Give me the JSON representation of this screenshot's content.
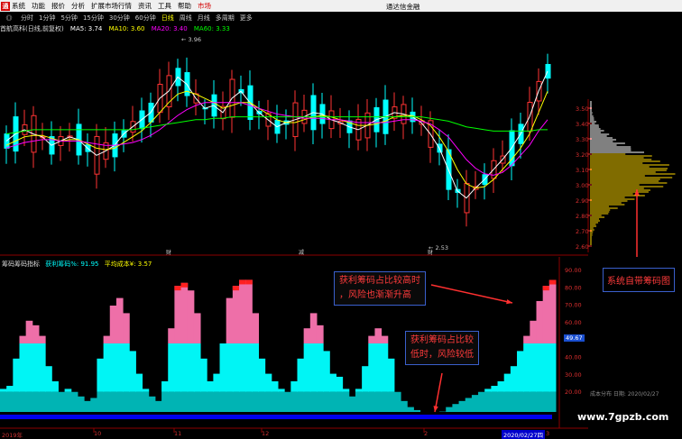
{
  "menu": {
    "logo": "通",
    "items": [
      "系统",
      "功能",
      "报价",
      "分析",
      "扩展市场行情",
      "资讯",
      "工具",
      "帮助",
      "市场"
    ],
    "active_index": 8,
    "brand": "通达信金融"
  },
  "periods": {
    "symbol_glyph": "《》",
    "items": [
      "分时",
      "1分钟",
      "5分钟",
      "15分钟",
      "30分钟",
      "60分钟",
      "日线",
      "周线",
      "月线",
      "多周期",
      "更多"
    ],
    "active_index": 6
  },
  "stock": {
    "name": "首航高科(日线,前复权)",
    "ma_lines": [
      {
        "label": "MA5: 3.74",
        "color": "#ffffff"
      },
      {
        "label": "MA10: 3.60",
        "color": "#ffff00"
      },
      {
        "label": "MA20: 3.40",
        "color": "#ff00ff"
      },
      {
        "label": "MA60: 3.33",
        "color": "#00ff00"
      }
    ],
    "high_label": "3.96",
    "low_label": "2.53",
    "markers": [
      "财",
      "减",
      "财"
    ]
  },
  "price_axis": [
    "3.50",
    "3.40",
    "3.30",
    "3.20",
    "3.10",
    "3.00",
    "2.90",
    "2.80",
    "2.70",
    "2.60"
  ],
  "indicator": {
    "name": "筹码筹码指标",
    "series": [
      {
        "label": "获利筹码%: 91.95",
        "color": "#00ffff"
      },
      {
        "label": "平均成本¥: 3.57",
        "color": "#ffff00"
      }
    ],
    "axis": [
      "90.00",
      "80.00",
      "70.00",
      "60.00",
      "50.00",
      "40.00",
      "30.00",
      "20.00"
    ],
    "current_value": "49.67",
    "cost_label": "成本分布 日期: 2020/02/27"
  },
  "date_axis": {
    "labels": [
      "2019年",
      "10",
      "11",
      "12",
      "2",
      "3"
    ],
    "selected_date": "2020/02/27四"
  },
  "annotations": {
    "high": [
      "获利筹码占比较高时",
      "，风险也渐渐升高"
    ],
    "low": [
      "获利筹码占比较",
      "低时，风险较低"
    ],
    "system": "系统自带筹码图"
  },
  "watermark": "www.7gpzb.com",
  "colors": {
    "up": "#ff3333",
    "down": "#00ffff",
    "profit_high": "#ee6fa8",
    "profit_mid": "#00f5f5",
    "profit_base": "#00b4b4",
    "base_band": "#0000ee",
    "grid": "#8b0000",
    "chip": "#ffffff",
    "chip_profit": "#ffd700"
  },
  "chart_data": [
    {
      "type": "line",
      "title": "首航高科(日线,前复权)",
      "ylim": [
        2.5,
        4.0
      ],
      "series": [
        {
          "name": "MA5",
          "values": [
            3.25,
            3.3,
            3.33,
            3.3,
            3.28,
            3.22,
            3.25,
            3.28,
            3.26,
            3.2,
            3.15,
            3.18,
            3.22,
            3.3,
            3.35,
            3.4,
            3.45,
            3.55,
            3.6,
            3.7,
            3.65,
            3.55,
            3.48,
            3.5,
            3.45,
            3.55,
            3.6,
            3.52,
            3.45,
            3.4,
            3.35,
            3.38,
            3.4,
            3.42,
            3.45,
            3.44,
            3.4,
            3.38,
            3.35,
            3.33,
            3.36,
            3.4,
            3.42,
            3.45,
            3.44,
            3.42,
            3.38,
            3.3,
            3.2,
            3.05,
            2.9,
            2.85,
            2.92,
            2.98,
            3.05,
            3.12,
            3.2,
            3.3,
            3.42,
            3.6,
            3.74
          ]
        },
        {
          "name": "MA10",
          "values": [
            3.22,
            3.25,
            3.28,
            3.29,
            3.29,
            3.27,
            3.25,
            3.26,
            3.26,
            3.23,
            3.2,
            3.19,
            3.2,
            3.24,
            3.28,
            3.32,
            3.38,
            3.45,
            3.52,
            3.58,
            3.6,
            3.58,
            3.55,
            3.52,
            3.48,
            3.5,
            3.52,
            3.52,
            3.48,
            3.44,
            3.4,
            3.38,
            3.38,
            3.4,
            3.42,
            3.43,
            3.42,
            3.4,
            3.38,
            3.36,
            3.36,
            3.37,
            3.39,
            3.42,
            3.43,
            3.43,
            3.4,
            3.36,
            3.28,
            3.18,
            3.05,
            2.95,
            2.92,
            2.93,
            2.98,
            3.05,
            3.12,
            3.2,
            3.3,
            3.45,
            3.6
          ]
        },
        {
          "name": "MA20",
          "values": [
            3.2,
            3.22,
            3.24,
            3.25,
            3.26,
            3.26,
            3.25,
            3.25,
            3.25,
            3.24,
            3.23,
            3.22,
            3.22,
            3.23,
            3.24,
            3.26,
            3.29,
            3.33,
            3.38,
            3.43,
            3.47,
            3.5,
            3.52,
            3.52,
            3.52,
            3.52,
            3.52,
            3.5,
            3.48,
            3.46,
            3.44,
            3.43,
            3.42,
            3.41,
            3.41,
            3.41,
            3.4,
            3.4,
            3.39,
            3.38,
            3.38,
            3.38,
            3.38,
            3.39,
            3.4,
            3.4,
            3.39,
            3.37,
            3.33,
            3.28,
            3.2,
            3.12,
            3.06,
            3.02,
            3.01,
            3.03,
            3.08,
            3.15,
            3.22,
            3.32,
            3.4
          ]
        },
        {
          "name": "MA60",
          "values": [
            3.3,
            3.31,
            3.32,
            3.33,
            3.33,
            3.33,
            3.33,
            3.33,
            3.33,
            3.33,
            3.33,
            3.33,
            3.33,
            3.33,
            3.33,
            3.34,
            3.35,
            3.36,
            3.37,
            3.38,
            3.39,
            3.4,
            3.4,
            3.41,
            3.41,
            3.42,
            3.42,
            3.42,
            3.42,
            3.42,
            3.42,
            3.42,
            3.42,
            3.42,
            3.42,
            3.42,
            3.42,
            3.42,
            3.42,
            3.42,
            3.42,
            3.42,
            3.42,
            3.42,
            3.42,
            3.42,
            3.42,
            3.41,
            3.4,
            3.39,
            3.37,
            3.35,
            3.34,
            3.33,
            3.32,
            3.32,
            3.32,
            3.32,
            3.32,
            3.33,
            3.33
          ]
        }
      ]
    },
    {
      "type": "bar",
      "title": "筹码筹码指标",
      "ylim": [
        0,
        100
      ],
      "series": [
        {
          "name": "获利筹码%",
          "values": [
            20,
            22,
            40,
            55,
            65,
            62,
            55,
            35,
            25,
            18,
            20,
            18,
            15,
            12,
            14,
            40,
            55,
            75,
            80,
            70,
            45,
            30,
            20,
            15,
            12,
            25,
            60,
            88,
            90,
            85,
            70,
            40,
            25,
            30,
            50,
            80,
            88,
            92,
            92,
            70,
            40,
            30,
            25,
            20,
            18,
            25,
            40,
            60,
            70,
            62,
            45,
            30,
            28,
            20,
            15,
            20,
            35,
            55,
            60,
            55,
            40,
            18,
            12,
            8,
            6,
            3,
            2,
            2,
            5,
            8,
            10,
            12,
            14,
            16,
            18,
            20,
            22,
            25,
            30,
            35,
            45,
            55,
            65,
            78,
            88,
            91.95
          ]
        }
      ]
    }
  ]
}
